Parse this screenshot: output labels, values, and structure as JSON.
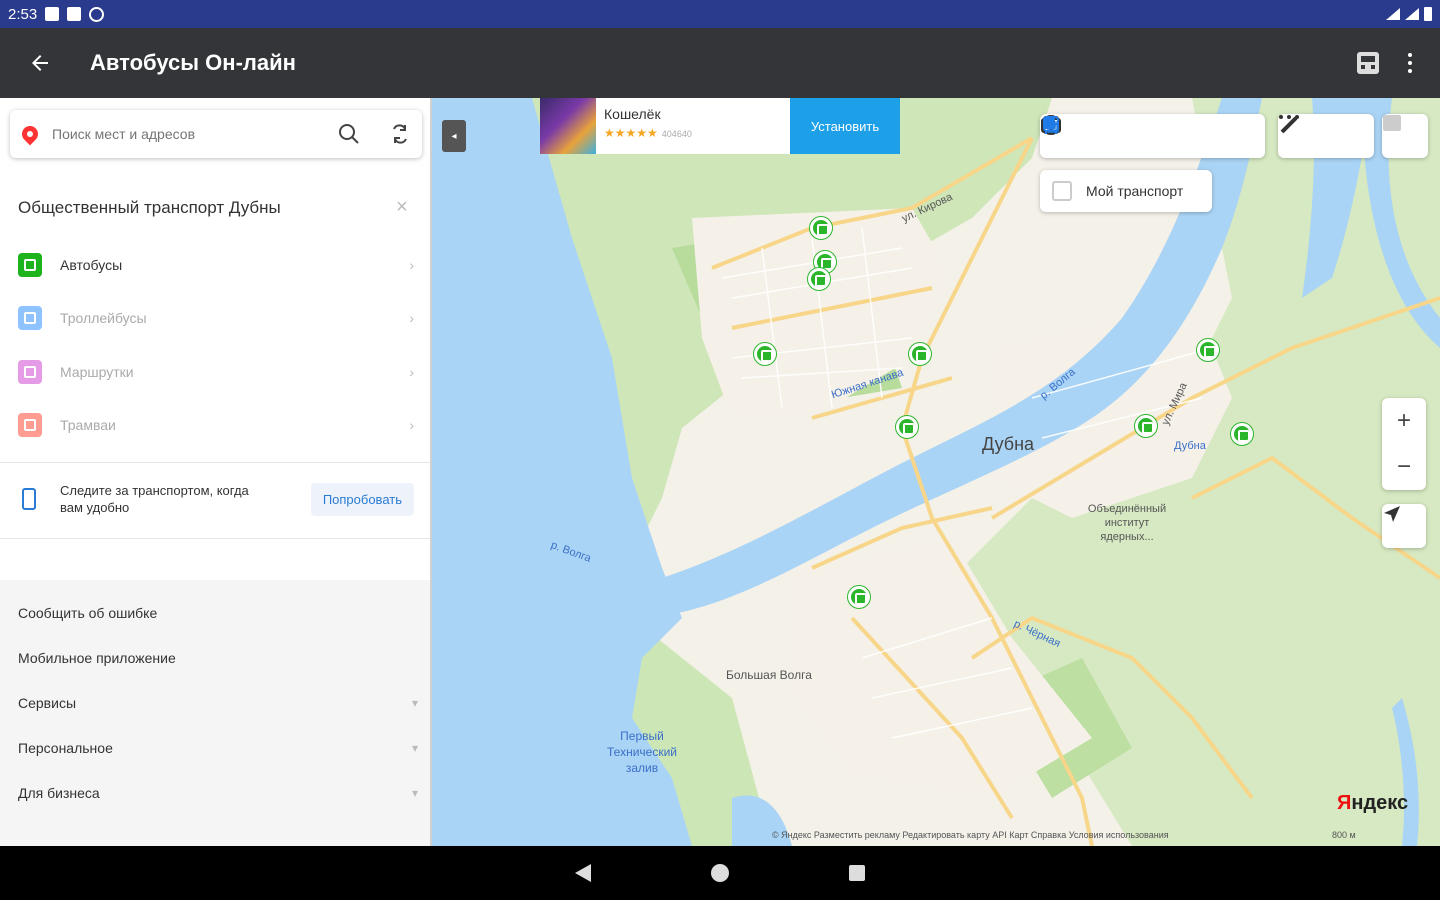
{
  "statusbar": {
    "time": "2:53"
  },
  "appbar": {
    "title": "Автобусы Он-лайн"
  },
  "panel": {
    "search_placeholder": "Поиск мест и адресов",
    "transport_title": "Общественный транспорт Дубны",
    "close": "×",
    "items": [
      {
        "label": "Автобусы",
        "color": "#1db31d"
      },
      {
        "label": "Троллейбусы",
        "color": "#8fc3ff"
      },
      {
        "label": "Маршрутки",
        "color": "#e59be6"
      },
      {
        "label": "Трамваи",
        "color": "#ff9c92"
      }
    ],
    "promo_text": "Следите за транспортом, когда вам удобно",
    "promo_button": "Попробовать",
    "links": [
      {
        "label": "Сообщить об ошибке",
        "chev": ""
      },
      {
        "label": "Мобильное приложение",
        "chev": ""
      },
      {
        "label": "Сервисы",
        "chev": "▾"
      },
      {
        "label": "Персональное",
        "chev": "▾"
      },
      {
        "label": "Для бизнеса",
        "chev": "▾"
      }
    ]
  },
  "map": {
    "ad": {
      "name": "Кошелёк",
      "stars": "★★★★★",
      "reviews": "404640",
      "button": "Установить"
    },
    "my_transport": "Мой транспорт",
    "zoom_in": "+",
    "zoom_out": "−",
    "city": "Дубна",
    "labels": {
      "kirova": "ул. Кирова",
      "yuzhnaya": "Южная канава",
      "volga_river": "р. Волга",
      "volga_river2": "р. Волга",
      "institute": "Объединённый институт ядерных...",
      "bolshaya_volga": "Большая Волга",
      "zaliv": "Первый Технический залив",
      "dubna_station": "Дубна",
      "mira": "ул. Мира",
      "chernaya": "р. Чёрная"
    },
    "logo_red": "Я",
    "logo_black": "ндекс",
    "copyright": "© Яндекс   Разместить рекламу   Редактировать карту   API Карт   Справка   Условия использования",
    "scale": "800 м"
  }
}
